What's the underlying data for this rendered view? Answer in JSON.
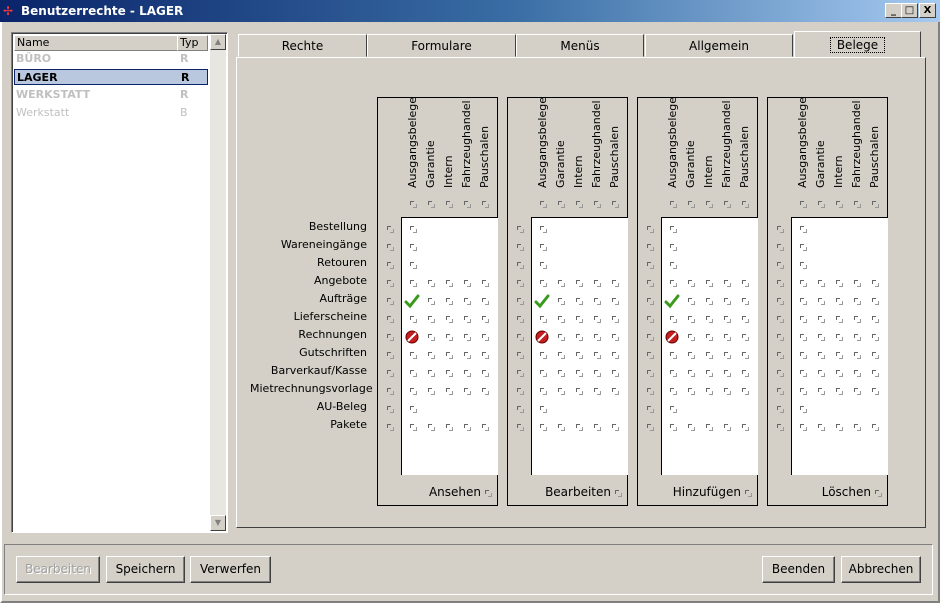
{
  "window": {
    "title": "Benutzerrechte - LAGER",
    "buttons": [
      "_",
      "□",
      "X"
    ]
  },
  "userlist": {
    "headers": {
      "name": "Name",
      "type": "Typ"
    },
    "rows": [
      {
        "name": "BÜRO",
        "type": "R",
        "style": "bold"
      },
      {
        "name": "LAGER",
        "type": "R",
        "style": "selected"
      },
      {
        "name": "WERKSTATT",
        "type": "R",
        "style": "bold"
      },
      {
        "name": "Werkstatt",
        "type": "B",
        "style": "normal"
      }
    ]
  },
  "tabs": [
    "Rechte",
    "Formulare",
    "Menüs",
    "Allgemein",
    "Belege"
  ],
  "active_tab": "Belege",
  "columns": [
    "Ausgangsbelege",
    "Garantie",
    "Intern",
    "Fahrzeughandel",
    "Pauschalen"
  ],
  "rows": [
    "Bestellung",
    "Wareneingänge",
    "Retouren",
    "Angebote",
    "Aufträge",
    "Lieferscheine",
    "Rechnungen",
    "Gutschriften",
    "Barverkauf/Kasse",
    "Mietrechnungsvorlage",
    "AU-Beleg",
    "Pakete"
  ],
  "groups": [
    {
      "label": "Ansehen",
      "granted": [
        "Aufträge"
      ],
      "denied": [
        "Rechnungen"
      ]
    },
    {
      "label": "Bearbeiten",
      "granted": [
        "Aufträge"
      ],
      "denied": [
        "Rechnungen"
      ]
    },
    {
      "label": "Hinzufügen",
      "granted": [
        "Aufträge"
      ],
      "denied": [
        "Rechnungen"
      ]
    },
    {
      "label": "Löschen",
      "granted": [],
      "denied": []
    }
  ],
  "single_column_rows": [
    "Bestellung",
    "Wareneingänge",
    "Retouren",
    "AU-Beleg"
  ],
  "buttons": {
    "edit": "Bearbeiten",
    "save": "Speichern",
    "discard": "Verwerfen",
    "exit": "Beenden",
    "cancel": "Abbrechen"
  },
  "colors": {
    "titlebar": "#0a246a",
    "selection": "#b9c8df",
    "granted": "#3a9a1e",
    "denied": "#c41e1e"
  }
}
